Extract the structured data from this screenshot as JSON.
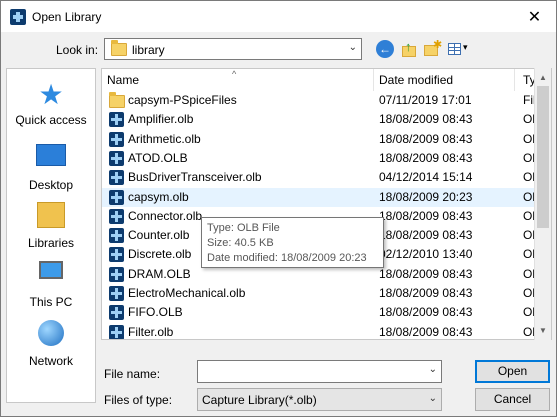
{
  "window": {
    "title": "Open Library",
    "close_glyph": "✕"
  },
  "toolbar": {
    "lookin_label": "Look in:",
    "lookin_value": "library",
    "back_glyph": "←",
    "up_glyph": "↑",
    "view_dropdown_glyph": "▾"
  },
  "places": [
    {
      "label": "Quick access",
      "icon": "quick-access-star-icon"
    },
    {
      "label": "Desktop",
      "icon": "desktop-icon"
    },
    {
      "label": "Libraries",
      "icon": "libraries-icon"
    },
    {
      "label": "This PC",
      "icon": "this-pc-icon"
    },
    {
      "label": "Network",
      "icon": "network-icon"
    }
  ],
  "columns": {
    "name": "Name",
    "date": "Date modified",
    "type": "Ty"
  },
  "files": [
    {
      "name": "capsym-PSpiceFiles",
      "date": "07/11/2019 17:01",
      "type": "Fil",
      "kind": "folder"
    },
    {
      "name": "Amplifier.olb",
      "date": "18/08/2009 08:43",
      "type": "Ol",
      "kind": "olb"
    },
    {
      "name": "Arithmetic.olb",
      "date": "18/08/2009 08:43",
      "type": "Ol",
      "kind": "olb"
    },
    {
      "name": "ATOD.OLB",
      "date": "18/08/2009 08:43",
      "type": "Ol",
      "kind": "olb"
    },
    {
      "name": "BusDriverTransceiver.olb",
      "date": "04/12/2014 15:14",
      "type": "Ol",
      "kind": "olb"
    },
    {
      "name": "capsym.olb",
      "date": "18/08/2009 20:23",
      "type": "Ol",
      "kind": "olb",
      "selected": true
    },
    {
      "name": "Connector.olb",
      "date": "18/08/2009 08:43",
      "type": "Ol",
      "kind": "olb"
    },
    {
      "name": "Counter.olb",
      "date": "18/08/2009 08:43",
      "type": "Ol",
      "kind": "olb"
    },
    {
      "name": "Discrete.olb",
      "date": "02/12/2010 13:40",
      "type": "Ol",
      "kind": "olb"
    },
    {
      "name": "DRAM.OLB",
      "date": "18/08/2009 08:43",
      "type": "Ol",
      "kind": "olb"
    },
    {
      "name": "ElectroMechanical.olb",
      "date": "18/08/2009 08:43",
      "type": "Ol",
      "kind": "olb"
    },
    {
      "name": "FIFO.OLB",
      "date": "18/08/2009 08:43",
      "type": "Ol",
      "kind": "olb"
    },
    {
      "name": "Filter.olb",
      "date": "18/08/2009 08:43",
      "type": "Ol",
      "kind": "olb"
    }
  ],
  "tooltip": {
    "type_line": "Type: OLB File",
    "size_line": "Size: 40.5 KB",
    "date_line": "Date modified: 18/08/2009 20:23"
  },
  "form": {
    "filename_label": "File name:",
    "filename_value": "",
    "filetype_label": "Files of type:",
    "filetype_value": "Capture Library(*.olb)",
    "dropdown_glyph": "⌵"
  },
  "buttons": {
    "open": "Open",
    "cancel": "Cancel"
  }
}
